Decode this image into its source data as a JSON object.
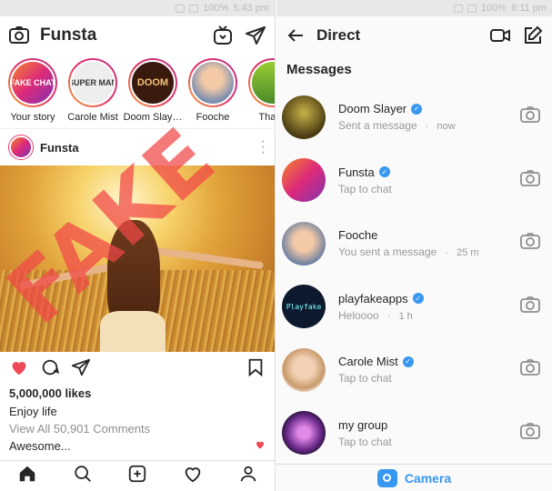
{
  "left": {
    "status": {
      "battery": "100%",
      "time": "5:43 pm"
    },
    "header": {
      "title": "Funsta"
    },
    "stories": [
      {
        "label": "Your story",
        "avatar_text": "FAKE CHAT"
      },
      {
        "label": "Carole Mist",
        "avatar_text": "SUPER MAN"
      },
      {
        "label": "Doom Slay…",
        "avatar_text": "DOOM"
      },
      {
        "label": "Fooche",
        "avatar_text": ""
      },
      {
        "label": "Thatte",
        "avatar_text": ""
      }
    ],
    "post": {
      "author": "Funsta",
      "likes": "5,000,000 likes",
      "caption": "Enjoy life",
      "comments_link": "View All 50,901 Comments",
      "comment": "Awesome..."
    }
  },
  "right": {
    "status": {
      "battery": "100%",
      "time": "6:11 pm"
    },
    "header": {
      "title": "Direct"
    },
    "section_title": "Messages",
    "threads": [
      {
        "name": "Doom Slayer",
        "sub": "Sent a message",
        "time": "now",
        "verified": true
      },
      {
        "name": "Funsta",
        "sub": "Tap to chat",
        "time": "",
        "verified": true
      },
      {
        "name": "Fooche",
        "sub": "You sent a message",
        "time": "25 m",
        "verified": false
      },
      {
        "name": "playfakeapps",
        "sub": "Heloooo",
        "time": "1 h",
        "verified": true,
        "avatar_text": "Playfake"
      },
      {
        "name": "Carole Mist",
        "sub": "Tap to chat",
        "time": "",
        "verified": true
      },
      {
        "name": "my group",
        "sub": "Tap to chat",
        "time": "",
        "verified": false
      }
    ],
    "camera_label": "Camera"
  },
  "watermark": "FAKE",
  "colors": {
    "accent": "#3897f0",
    "heart": "#ed4956",
    "watermark": "#f04646"
  }
}
